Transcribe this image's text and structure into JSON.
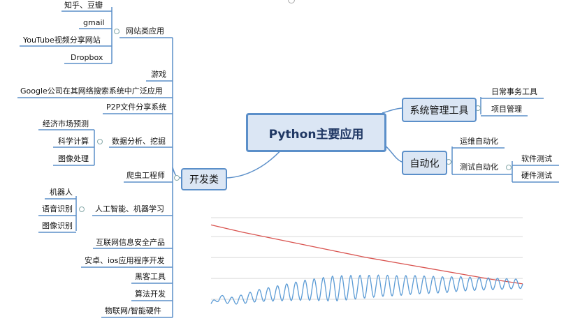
{
  "mindmap": {
    "central": "Python主要应用",
    "dev": {
      "label": "开发类",
      "website": {
        "label": "网站类应用",
        "children": [
          "知乎、豆瓣",
          "gmail",
          "YouTube视频分享网站",
          "Dropbox"
        ]
      },
      "game": "游戏",
      "google": "Google公司在其网络搜索系统中广泛应用",
      "p2p": "P2P文件分享系统",
      "data": {
        "label": "数据分析、挖掘",
        "children": [
          "经济市场预测",
          "科学计算",
          "图像处理"
        ]
      },
      "crawler": "爬虫工程师",
      "ai": {
        "label": "人工智能、机器学习",
        "children": [
          "机器人",
          "语音识别",
          "图像识别"
        ]
      },
      "security": "互联网信息安全产品",
      "mobile": "安卓、ios应用程序开发",
      "hacker": "黑客工具",
      "algo": "算法开发",
      "iot": "物联网/智能硬件"
    },
    "sys": {
      "label": "系统管理工具",
      "children": [
        "日常事务工具",
        "项目管理"
      ]
    },
    "auto": {
      "label": "自动化",
      "ops": "运维自动化",
      "test": {
        "label": "测试自动化",
        "children": [
          "软件测试",
          "硬件测试"
        ]
      }
    }
  },
  "colors": {
    "branch": "#5b8fc9",
    "node_fill": "#dbe6f4",
    "red_line": "#d9534f",
    "blue_line": "#5b9bd5",
    "grid": "#d9d9d9"
  },
  "chart_data": {
    "type": "line",
    "title": "",
    "xlabel": "",
    "ylabel": "",
    "grid": true,
    "ylim": [
      0,
      1
    ],
    "series": [
      {
        "x": [
          0,
          10,
          20,
          30,
          40,
          50,
          60,
          70,
          80,
          90,
          100
        ],
        "y": [
          0.92,
          0.84,
          0.77,
          0.7,
          0.63,
          0.56,
          0.5,
          0.44,
          0.38,
          0.32,
          0.27
        ]
      },
      {
        "x": [
          0,
          3,
          6,
          10,
          15,
          20,
          25,
          30,
          35,
          40,
          45,
          50,
          55,
          60,
          65,
          70,
          75,
          80,
          85,
          90,
          95,
          100
        ],
        "y": [
          0.05,
          0.12,
          0.08,
          0.1,
          0.14,
          0.16,
          0.18,
          0.2,
          0.21,
          0.22,
          0.23,
          0.24,
          0.25,
          0.25,
          0.26,
          0.26,
          0.26,
          0.27,
          0.27,
          0.27,
          0.27,
          0.27
        ],
        "oscillation": {
          "amplitude_start": 0.02,
          "amplitude_peak": 0.14,
          "amplitude_end": 0.05,
          "cycles": 34
        }
      }
    ]
  }
}
